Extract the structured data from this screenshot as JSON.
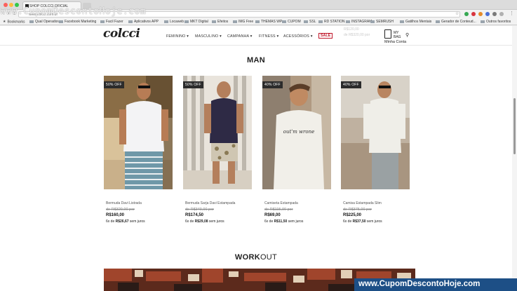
{
  "browser": {
    "tab_title": "SHOP COLCCI OFICIAL",
    "address": "www.colcci.com.br",
    "bookmarks": [
      "Bookmarks",
      "Qual Operadora",
      "Facebook Marketing",
      "Facil Fazer",
      "Aplicativos APP",
      "Locaweb",
      "MKT Digital",
      "Efeitos",
      "IMG Free",
      "THEMAS WP",
      "CUPOM",
      "SSL",
      "RD STATION",
      "INSTAGRAM",
      "SEMRUSH",
      "Gatilhos Mentais",
      "Gerador de Conteud...",
      "Outros favoritos"
    ]
  },
  "watermark": {
    "top": "www.CupomDescontoHoje.com",
    "bottom": "www.CupomDescontoHoje.com"
  },
  "header": {
    "logo": "colcci",
    "menu": [
      "FEMININO",
      "MASCULINO",
      "CAMPANHA",
      "FITNESS",
      "ACESSÓRIOS"
    ],
    "sale": "SALE",
    "bag_label": [
      "MY",
      "BAG"
    ],
    "account": "Minha Conta"
  },
  "section_man": "MAN",
  "products": [
    {
      "badge": "50% OFF",
      "name": "Bermuda Davi Listrada",
      "old_price": "de R$320,00 por",
      "price": "R$160,00",
      "installments_count": "6x de",
      "installment_value": "R$26,67",
      "installments_suffix": "sem juros"
    },
    {
      "badge": "50% OFF",
      "name": "Bermuda Sarja Davi Estampada",
      "old_price": "de R$349,00 por",
      "price": "R$174,50",
      "installments_count": "6x de",
      "installment_value": "R$29,08",
      "installments_suffix": "sem juros"
    },
    {
      "badge": "40% OFF",
      "name": "Camiseta Estampada",
      "old_price": "de R$115,00 por",
      "price": "R$69,00",
      "installments_count": "6x de",
      "installment_value": "R$11,50",
      "installments_suffix": "sem juros"
    },
    {
      "badge": "40% OFF",
      "name": "Camisa Estampada Slim",
      "old_price": "de R$375,00 por",
      "price": "R$225,00",
      "installments_count": "6x de",
      "installment_value": "R$37,50",
      "installments_suffix": "sem juros"
    }
  ],
  "section_work": {
    "bold": "WORK",
    "light": "OUT"
  },
  "colors": {
    "badge": "#2b2b2b",
    "sale": "#c0172a",
    "watermark_bg": "#1d4f86"
  }
}
